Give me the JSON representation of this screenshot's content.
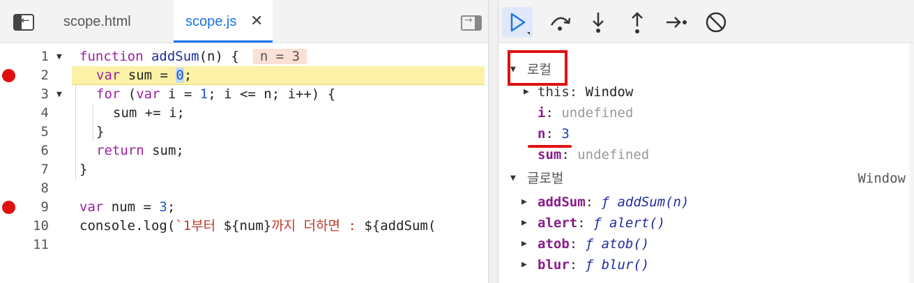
{
  "tabs": [
    {
      "label": "scope.html"
    },
    {
      "label": "scope.js"
    }
  ],
  "code_lines": [
    {
      "num": "1",
      "breakpoint": false
    },
    {
      "num": "2",
      "breakpoint": true
    },
    {
      "num": "3",
      "breakpoint": false
    },
    {
      "num": "4",
      "breakpoint": false
    },
    {
      "num": "5",
      "breakpoint": false
    },
    {
      "num": "6",
      "breakpoint": false
    },
    {
      "num": "7",
      "breakpoint": false
    },
    {
      "num": "8",
      "breakpoint": false
    },
    {
      "num": "9",
      "breakpoint": true
    },
    {
      "num": "10",
      "breakpoint": false
    },
    {
      "num": "11",
      "breakpoint": false
    }
  ],
  "code": {
    "l1": {
      "kw": "function",
      "name": "addSum",
      "rest": "(n) {",
      "inline": "n = 3"
    },
    "l2": {
      "kw": "var",
      "mid": " sum = ",
      "val": "0",
      "end": ";"
    },
    "l3": {
      "kw1": "for",
      "a": " (",
      "kw2": "var",
      "b": " i = ",
      "one": "1",
      "c": "; i <= n; i++) {"
    },
    "l4": "sum += i;",
    "l5": "}",
    "l6": {
      "kw": "return",
      "rest": " sum;"
    },
    "l7": "}",
    "l9": {
      "kw": "var",
      "mid": " num = ",
      "val": "3",
      "end": ";"
    },
    "l10": {
      "a": "console.log(",
      "s1": "`1부터 ",
      "b": "${num}",
      "s2": "까지 더하면 : ",
      "c": "${addSum("
    }
  },
  "scope": {
    "local_label": "로컬",
    "local_vars": [
      {
        "name": "this",
        "value": "Window"
      },
      {
        "name": "i",
        "value": "undefined"
      },
      {
        "name": "n",
        "value": "3"
      },
      {
        "name": "sum",
        "value": "undefined"
      }
    ],
    "global_label": "글로벌",
    "global_value": "Window",
    "global_vars": [
      {
        "name": "addSum",
        "f": "ƒ",
        "sig": "addSum(n)"
      },
      {
        "name": "alert",
        "f": "ƒ",
        "sig": "alert()"
      },
      {
        "name": "atob",
        "f": "ƒ",
        "sig": "atob()"
      },
      {
        "name": "blur",
        "f": "ƒ",
        "sig": "blur()"
      }
    ]
  },
  "colors": {
    "breakpoint": "#e0100f",
    "accent": "#1a73e8",
    "highlight_box": "#e01010"
  },
  "icons": [
    "sidebar-toggle-icon",
    "close-icon",
    "resume-icon",
    "step-over-icon",
    "step-into-icon",
    "step-out-icon",
    "step-icon",
    "deactivate-breakpoints-icon"
  ]
}
